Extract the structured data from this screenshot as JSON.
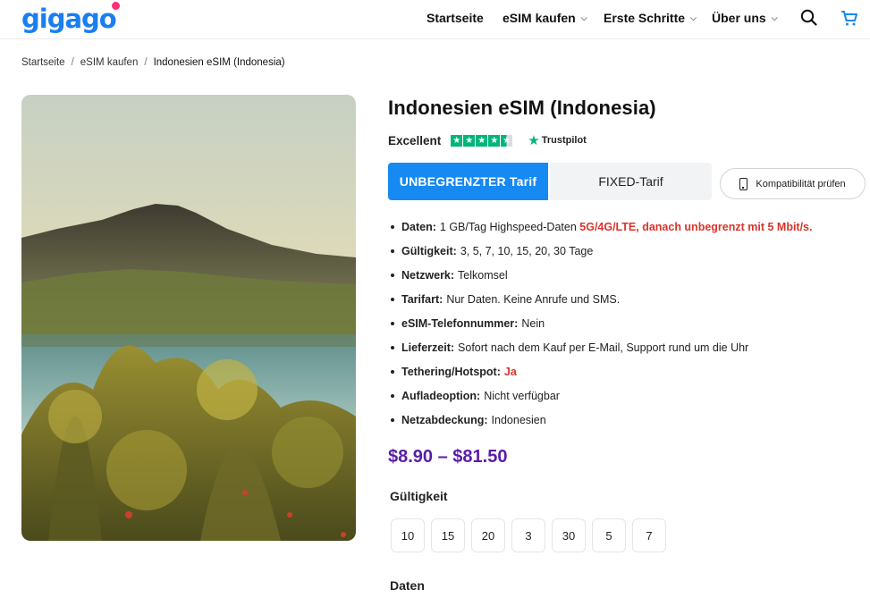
{
  "brand": {
    "logo_text": "gigago"
  },
  "nav": {
    "items": [
      {
        "label": "Startseite"
      },
      {
        "label": "eSIM kaufen"
      },
      {
        "label": "Erste Schritte"
      },
      {
        "label": "Über uns"
      }
    ],
    "icons": [
      "search-icon",
      "cart-icon"
    ]
  },
  "breadcrumb": {
    "items": [
      "Startseite",
      "eSIM kaufen",
      "Indonesien eSIM (Indonesia)"
    ],
    "separator": "/"
  },
  "product": {
    "title": "Indonesien eSIM (Indonesia)",
    "rating_label": "Excellent",
    "rating_stars": 4.5,
    "trustpilot_label": "Trustpilot",
    "tabs": [
      {
        "label": "UNBEGRENZTER Tarif",
        "active": true
      },
      {
        "label": "FIXED-Tarif",
        "active": false
      }
    ],
    "compat_button": "Kompatibilität prüfen",
    "features": [
      {
        "label": "Daten:",
        "text": "1 GB/Tag Highspeed-Daten",
        "highlight": "5G/4G/LTE, danach unbegrenzt mit 5 Mbit/s."
      },
      {
        "label": "Gültigkeit:",
        "text": "3, 5, 7, 10, 15, 20, 30 Tage",
        "highlight": ""
      },
      {
        "label": "Netzwerk:",
        "text": "Telkomsel",
        "highlight": ""
      },
      {
        "label": "Tarifart:",
        "text": "Nur Daten. Keine Anrufe und SMS.",
        "highlight": ""
      },
      {
        "label": "eSIM-Telefonnummer:",
        "text": "Nein",
        "highlight": ""
      },
      {
        "label": "Lieferzeit:",
        "text": "Sofort nach dem Kauf per E-Mail, Support rund um die Uhr",
        "highlight": ""
      },
      {
        "label": "Tethering/Hotspot:",
        "text": "",
        "highlight": "Ja"
      },
      {
        "label": "Aufladeoption:",
        "text": "Nicht verfügbar",
        "highlight": ""
      },
      {
        "label": "Netzabdeckung:",
        "text": "Indonesien",
        "highlight": ""
      }
    ],
    "price": "$8.90 – $81.50",
    "validity_label": "Gültigkeit",
    "validity_options": [
      "10",
      "15",
      "20",
      "3",
      "30",
      "5",
      "7"
    ],
    "data_label": "Daten"
  },
  "colors": {
    "accent": "#1689f3",
    "price": "#5a1da8",
    "highlight": "#d9342b",
    "trustpilot": "#00b67a",
    "logo_dot": "#ff2e7a"
  }
}
